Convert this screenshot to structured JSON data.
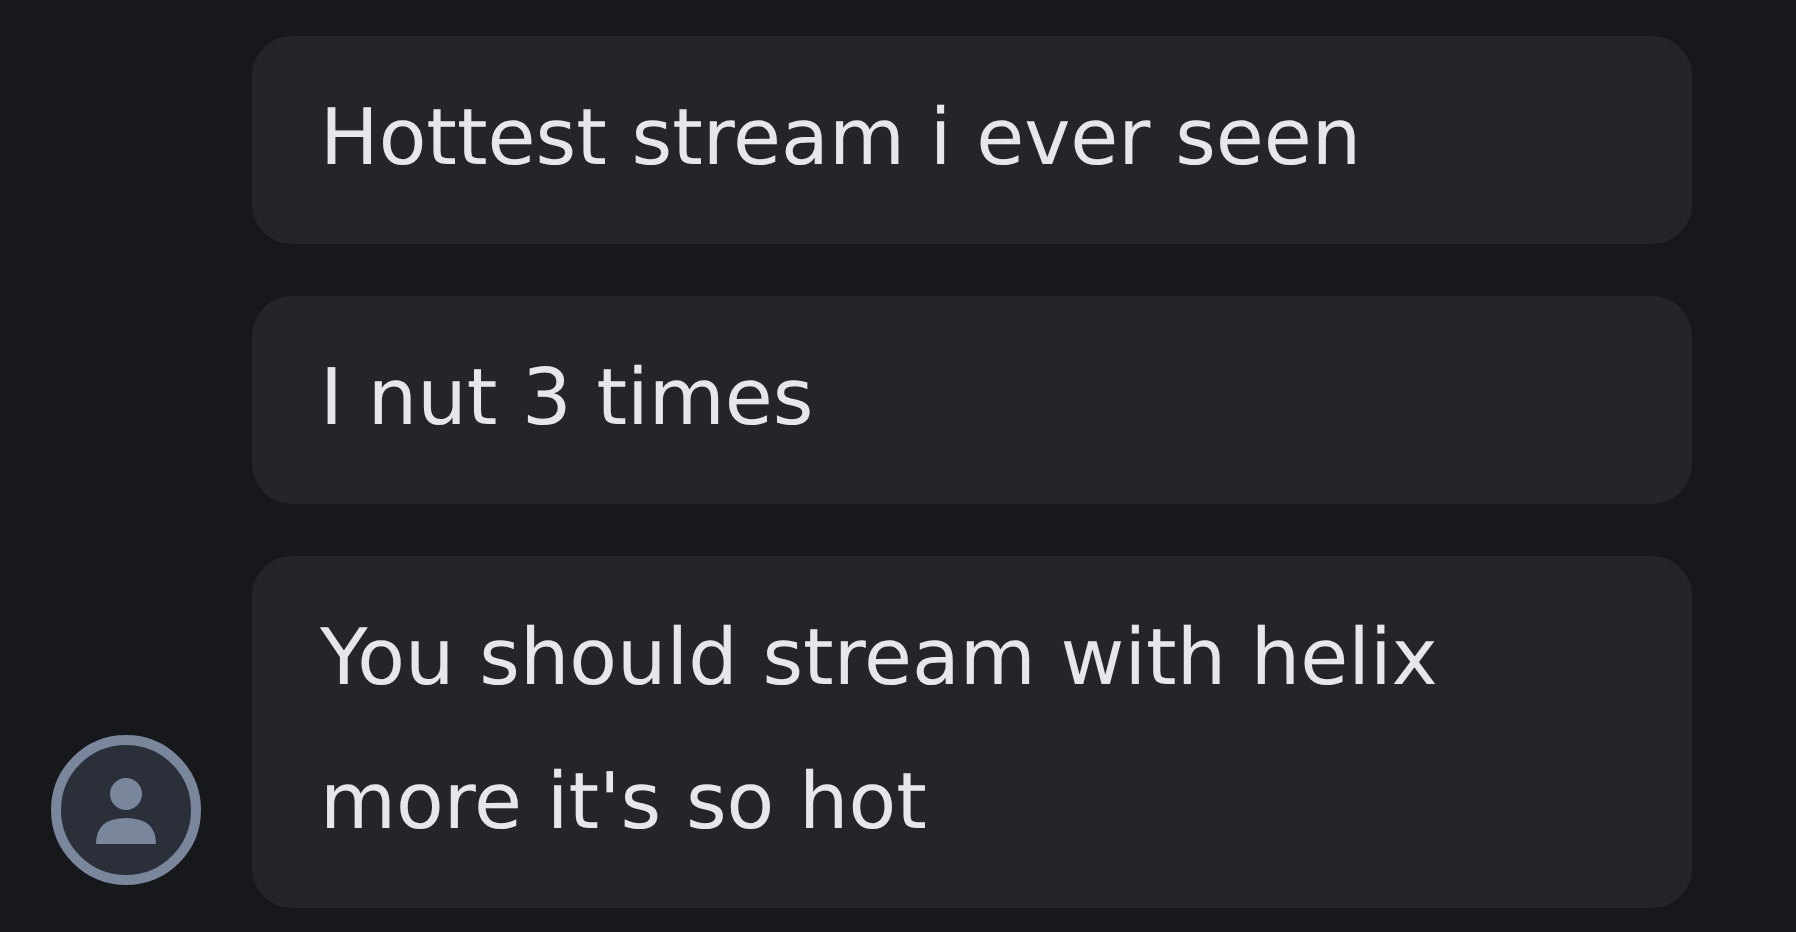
{
  "messages": [
    {
      "text": "Hottest stream i ever seen",
      "show_avatar": false
    },
    {
      "text": "I nut 3 times",
      "show_avatar": false
    },
    {
      "text": "You should stream with helix more it's so hot",
      "show_avatar": true
    }
  ]
}
